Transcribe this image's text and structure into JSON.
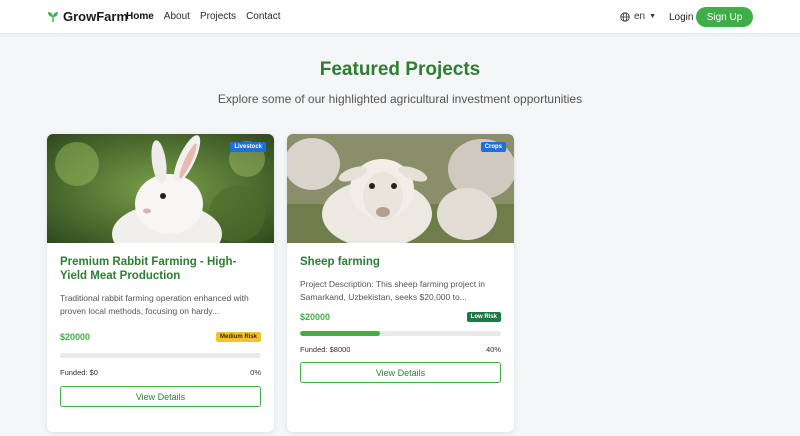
{
  "navbar": {
    "brand": "GrowFarm",
    "links": [
      {
        "label": "Home",
        "active": true
      },
      {
        "label": "About",
        "active": false
      },
      {
        "label": "Projects",
        "active": false
      },
      {
        "label": "Contact",
        "active": false
      }
    ],
    "language": "en",
    "login_label": "Login",
    "signup_label": "Sign Up"
  },
  "section": {
    "title": "Featured Projects",
    "subtitle": "Explore some of our highlighted agricultural investment opportunities"
  },
  "projects": [
    {
      "category": "Livestock",
      "title": "Premium Rabbit Farming - High-Yield Meat Production",
      "description": "Traditional rabbit farming operation enhanced with proven local methods, focusing on hardy...",
      "price": "$20000",
      "risk": "Medium Risk",
      "funded_label": "Funded: $0",
      "progress_percent_label": "0%",
      "progress": 0,
      "button_label": "View Details"
    },
    {
      "category": "Crops",
      "title": "Sheep farming",
      "description": "Project Description: This sheep farming project in Samarkand, Uzbekistan, seeks $20,000 to...",
      "price": "$20000",
      "risk": "Low Risk",
      "funded_label": "Funded: $8000",
      "progress_percent_label": "40%",
      "progress": 0.4,
      "button_label": "View Details"
    }
  ],
  "colors": {
    "brand_green": "#2e7d32",
    "accent_green": "#3fae49",
    "category_blue": "#1e6fd9",
    "medium_risk": "#f5c12e",
    "low_risk": "#1d7a46"
  }
}
